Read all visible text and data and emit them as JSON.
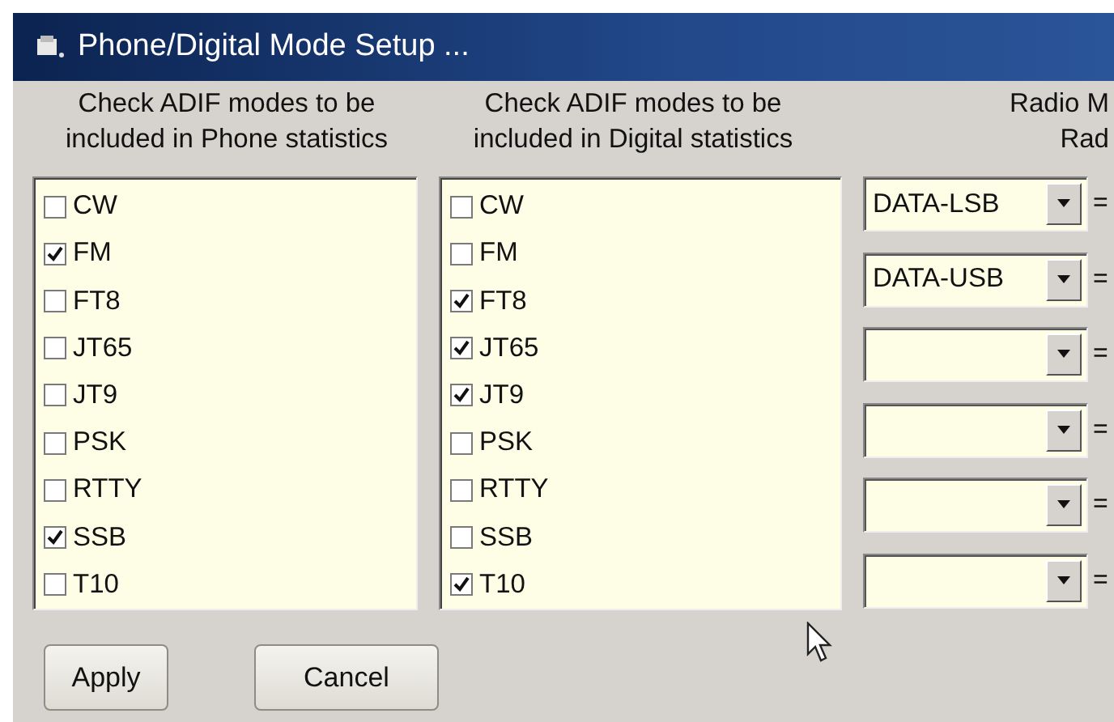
{
  "window": {
    "title": "Phone/Digital Mode Setup ..."
  },
  "phone_list": {
    "heading": "Check ADIF modes to be included in Phone statistics",
    "items": [
      {
        "label": "CW",
        "checked": false
      },
      {
        "label": "FM",
        "checked": true
      },
      {
        "label": "FT8",
        "checked": false
      },
      {
        "label": "JT65",
        "checked": false
      },
      {
        "label": "JT9",
        "checked": false
      },
      {
        "label": "PSK",
        "checked": false
      },
      {
        "label": "RTTY",
        "checked": false
      },
      {
        "label": "SSB",
        "checked": true
      },
      {
        "label": "T10",
        "checked": false
      }
    ]
  },
  "digital_list": {
    "heading": "Check ADIF modes to be included in Digital statistics",
    "items": [
      {
        "label": "CW",
        "checked": false
      },
      {
        "label": "FM",
        "checked": false
      },
      {
        "label": "FT8",
        "checked": true
      },
      {
        "label": "JT65",
        "checked": true
      },
      {
        "label": "JT9",
        "checked": true
      },
      {
        "label": "PSK",
        "checked": false
      },
      {
        "label": "RTTY",
        "checked": false
      },
      {
        "label": "SSB",
        "checked": false
      },
      {
        "label": "T10",
        "checked": true
      }
    ]
  },
  "radio_modes": {
    "heading_lines": [
      "Radio M",
      "Rad"
    ],
    "rows": [
      {
        "value": "DATA-LSB",
        "sign": "="
      },
      {
        "value": "DATA-USB",
        "sign": "="
      },
      {
        "sign": "="
      },
      {
        "sign": "="
      },
      {
        "sign": "="
      },
      {
        "sign": "="
      }
    ]
  },
  "buttons": [
    "Apply",
    "Cancel"
  ]
}
